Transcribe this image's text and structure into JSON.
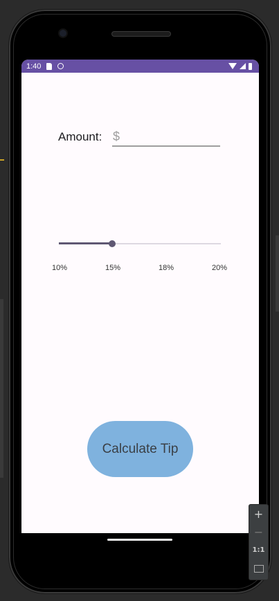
{
  "status_bar": {
    "time": "1:40",
    "left_icons": [
      "sd-card-icon",
      "notification-circle-icon"
    ],
    "right_icons": [
      "wifi-icon",
      "signal-icon",
      "battery-icon"
    ],
    "color": "#6750a4"
  },
  "form": {
    "amount_label": "Amount:",
    "amount_placeholder": "$",
    "amount_value": ""
  },
  "slider": {
    "value_label": "15%",
    "position_fraction": 0.33,
    "labels": [
      "10%",
      "15%",
      "18%",
      "20%"
    ]
  },
  "button": {
    "label": "Calculate Tip",
    "color": "#7fb2de"
  },
  "zoom_controls": {
    "plus": "+",
    "minus": "−",
    "one_to_one": "1:1"
  }
}
